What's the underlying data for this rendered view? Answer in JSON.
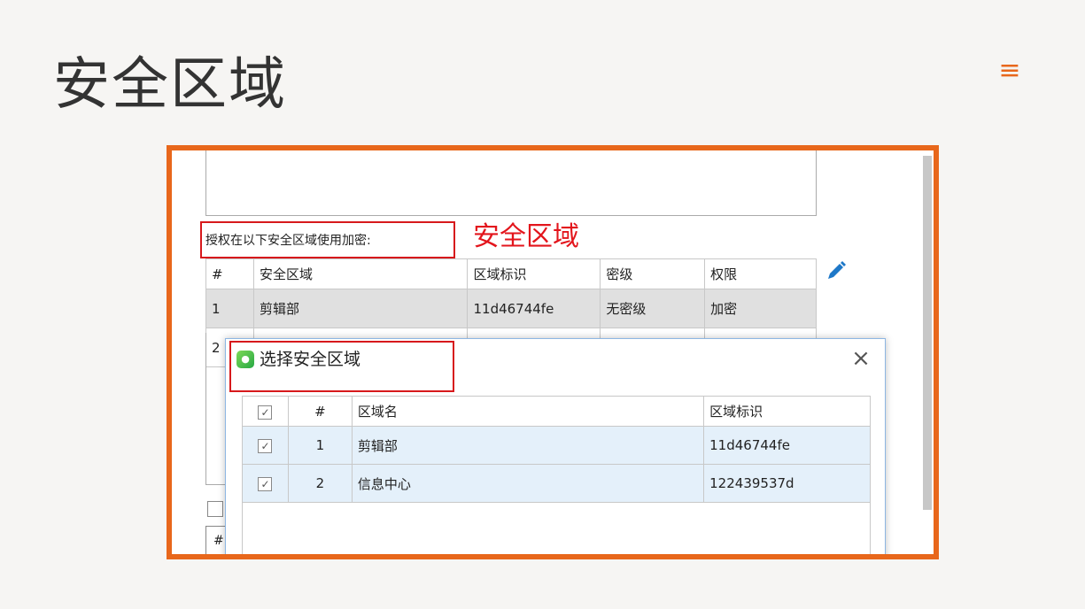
{
  "page": {
    "title": "安全区域",
    "menu_icon": "≡"
  },
  "screenshot": {
    "auth_label": "授权在以下安全区域使用加密:",
    "annotation": "安全区域",
    "main_table": {
      "headers": [
        "#",
        "安全区域",
        "区域标识",
        "密级",
        "权限"
      ],
      "rows": [
        [
          "1",
          "剪辑部",
          "11d46744fe",
          "无密级",
          "加密"
        ],
        [
          "2",
          "",
          "",
          "",
          ""
        ]
      ]
    },
    "left_hash": "#",
    "dialog": {
      "title": "选择安全区域",
      "close": "×",
      "headers": [
        "✓",
        "#",
        "区域名",
        "区域标识"
      ],
      "rows": [
        {
          "checked": "✓",
          "num": "1",
          "name": "剪辑部",
          "id": "11d46744fe"
        },
        {
          "checked": "✓",
          "num": "2",
          "name": "信息中心",
          "id": "122439537d"
        }
      ]
    }
  },
  "colors": {
    "accent": "#e8671b",
    "annotation_red": "#e3151c",
    "selected_row": "#e4f0fa"
  }
}
